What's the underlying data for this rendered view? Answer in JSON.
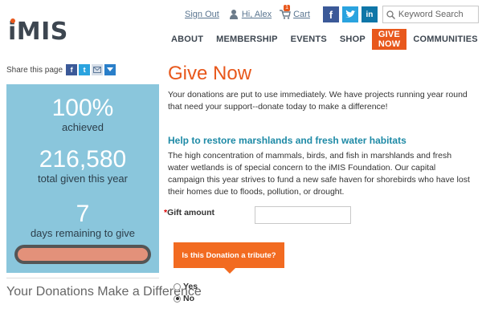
{
  "brand": {
    "logo": "iMIS",
    "accent": "#e8581c"
  },
  "utility": {
    "sign_out": "Sign Out",
    "user": "Hi, Alex",
    "cart": "Cart",
    "cart_count": "1",
    "search_placeholder": "Keyword Search",
    "social": [
      "facebook-icon",
      "twitter-icon",
      "linkedin-icon"
    ]
  },
  "nav": {
    "items": [
      "ABOUT",
      "MEMBERSHIP",
      "EVENTS",
      "SHOP",
      "GIVE NOW",
      "COMMUNITIES"
    ],
    "active": "GIVE NOW"
  },
  "share": {
    "label": "Share this page",
    "icons": [
      "facebook-icon",
      "twitter-icon",
      "email-icon",
      "add-icon"
    ]
  },
  "stats": {
    "percent": "100%",
    "percent_label": "achieved",
    "total": "216,580",
    "total_label": "total given this year",
    "days": "7",
    "days_label": "days remaining to give",
    "progress_fraction": 1.0
  },
  "sidebar_heading": "Your Donations Make a Difference",
  "main": {
    "title": "Give Now",
    "intro": "Your donations are put to use immediately. We have projects running year round that need your support--donate today to make a difference!",
    "subhead": "Help to restore marshlands and fresh water habitats",
    "body": "The high concentration of mammals, birds, and fish in marshlands and fresh water wetlands is of special concern to the iMIS Foundation. Our capital campaign this year strives to fund a new safe haven for shorebirds who have lost their homes due to floods, pollution, or drought.",
    "gift_required_mark": "*",
    "gift_label": "Gift amount",
    "gift_value": "",
    "tribute_label": "Is this Donation a tribute?",
    "tribute_options": [
      {
        "label": "Yes",
        "selected": false
      },
      {
        "label": "No",
        "selected": true
      }
    ]
  }
}
